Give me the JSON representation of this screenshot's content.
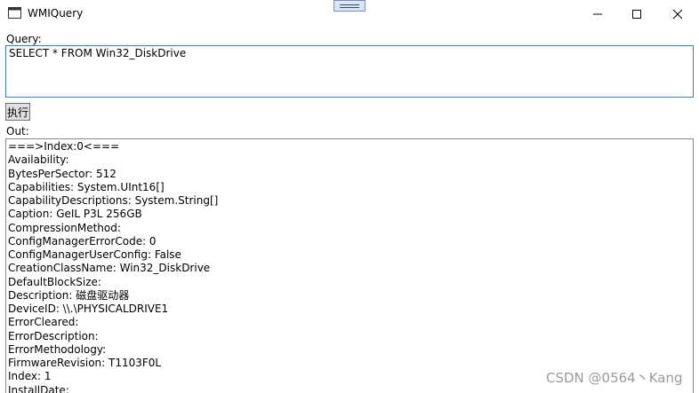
{
  "window": {
    "title": "WMIQuery"
  },
  "icons": {
    "app": "app-window-icon",
    "minimize": "minimize-icon",
    "maximize": "maximize-icon",
    "close": "close-icon",
    "drag": "drag-handle-icon"
  },
  "query": {
    "label": "Query:",
    "value": "SELECT * FROM Win32_DiskDrive"
  },
  "run_button": {
    "label": "执行"
  },
  "output": {
    "label": "Out:",
    "lines": [
      "===>Index:0<===",
      "Availability:",
      "BytesPerSector: 512",
      "Capabilities: System.UInt16[]",
      "CapabilityDescriptions: System.String[]",
      "Caption: GeIL P3L 256GB",
      "CompressionMethod:",
      "ConfigManagerErrorCode: 0",
      "ConfigManagerUserConfig: False",
      "CreationClassName: Win32_DiskDrive",
      "DefaultBlockSize:",
      "Description: 磁盘驱动器",
      "DeviceID: \\\\.\\PHYSICALDRIVE1",
      "ErrorCleared:",
      "ErrorDescription:",
      "ErrorMethodology:",
      "FirmwareRevision: T1103F0L",
      "Index: 1",
      "InstallDate:"
    ]
  },
  "watermark": "CSDN @0564丶Kang",
  "colors": {
    "focus_border": "#3a7bbd",
    "button_bg": "#e1e1e1",
    "button_border": "#707070"
  }
}
